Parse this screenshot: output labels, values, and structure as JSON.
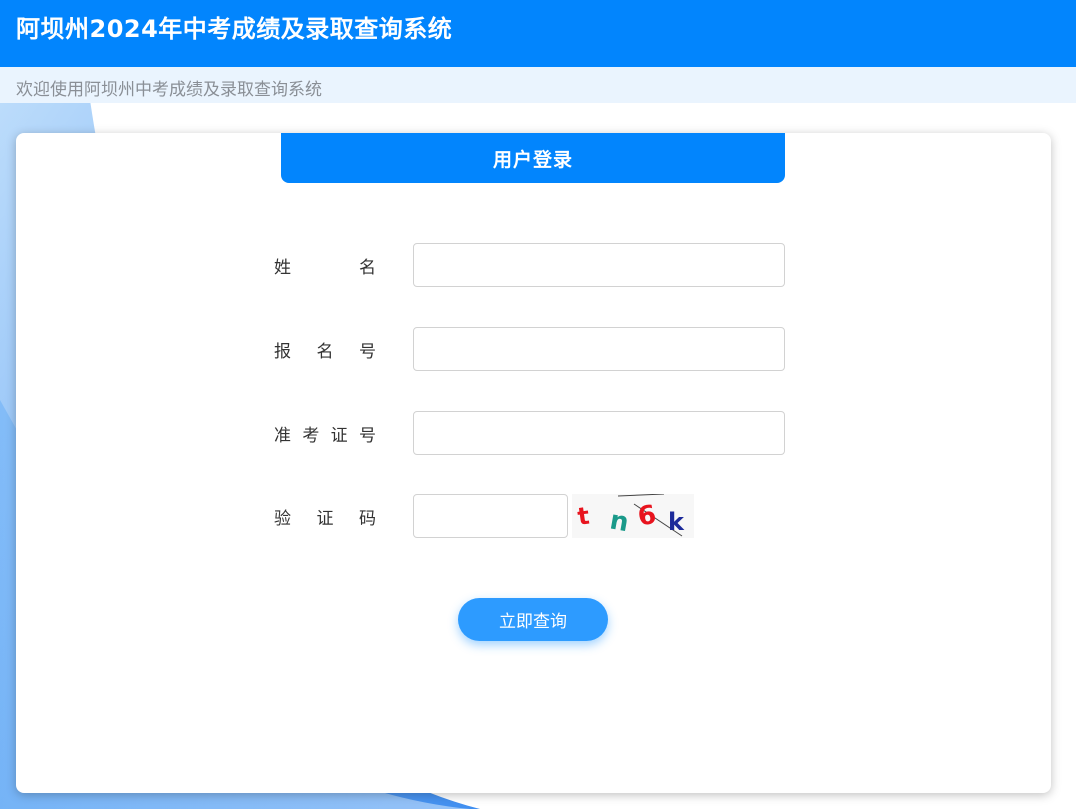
{
  "header": {
    "title": "阿坝州2024年中考成绩及录取查询系统"
  },
  "subbar": {
    "welcome": "欢迎使用阿坝州中考成绩及录取查询系统"
  },
  "login": {
    "tab_title": "用户登录",
    "fields": [
      {
        "label_chars": [
          "姓",
          "名"
        ],
        "value": "",
        "placeholder": ""
      },
      {
        "label_chars": [
          "报",
          "名",
          "号"
        ],
        "value": "",
        "placeholder": ""
      },
      {
        "label_chars": [
          "准",
          "考",
          "证",
          "号"
        ],
        "value": "",
        "placeholder": ""
      }
    ],
    "captcha": {
      "label_chars": [
        "验",
        "证",
        "码"
      ],
      "value": "",
      "placeholder": "",
      "code_chars": [
        {
          "char": "t",
          "color": "#e8141e"
        },
        {
          "char": "n",
          "color": "#1a9a8a"
        },
        {
          "char": "6",
          "color": "#e8141e"
        },
        {
          "char": "k",
          "color": "#1c2a9a"
        }
      ]
    },
    "submit_label": "立即查询"
  },
  "colors": {
    "primary": "#0285fd",
    "button": "#2d9bff",
    "subbar_bg": "#eaf4fe",
    "subbar_text": "#8a8f96"
  }
}
